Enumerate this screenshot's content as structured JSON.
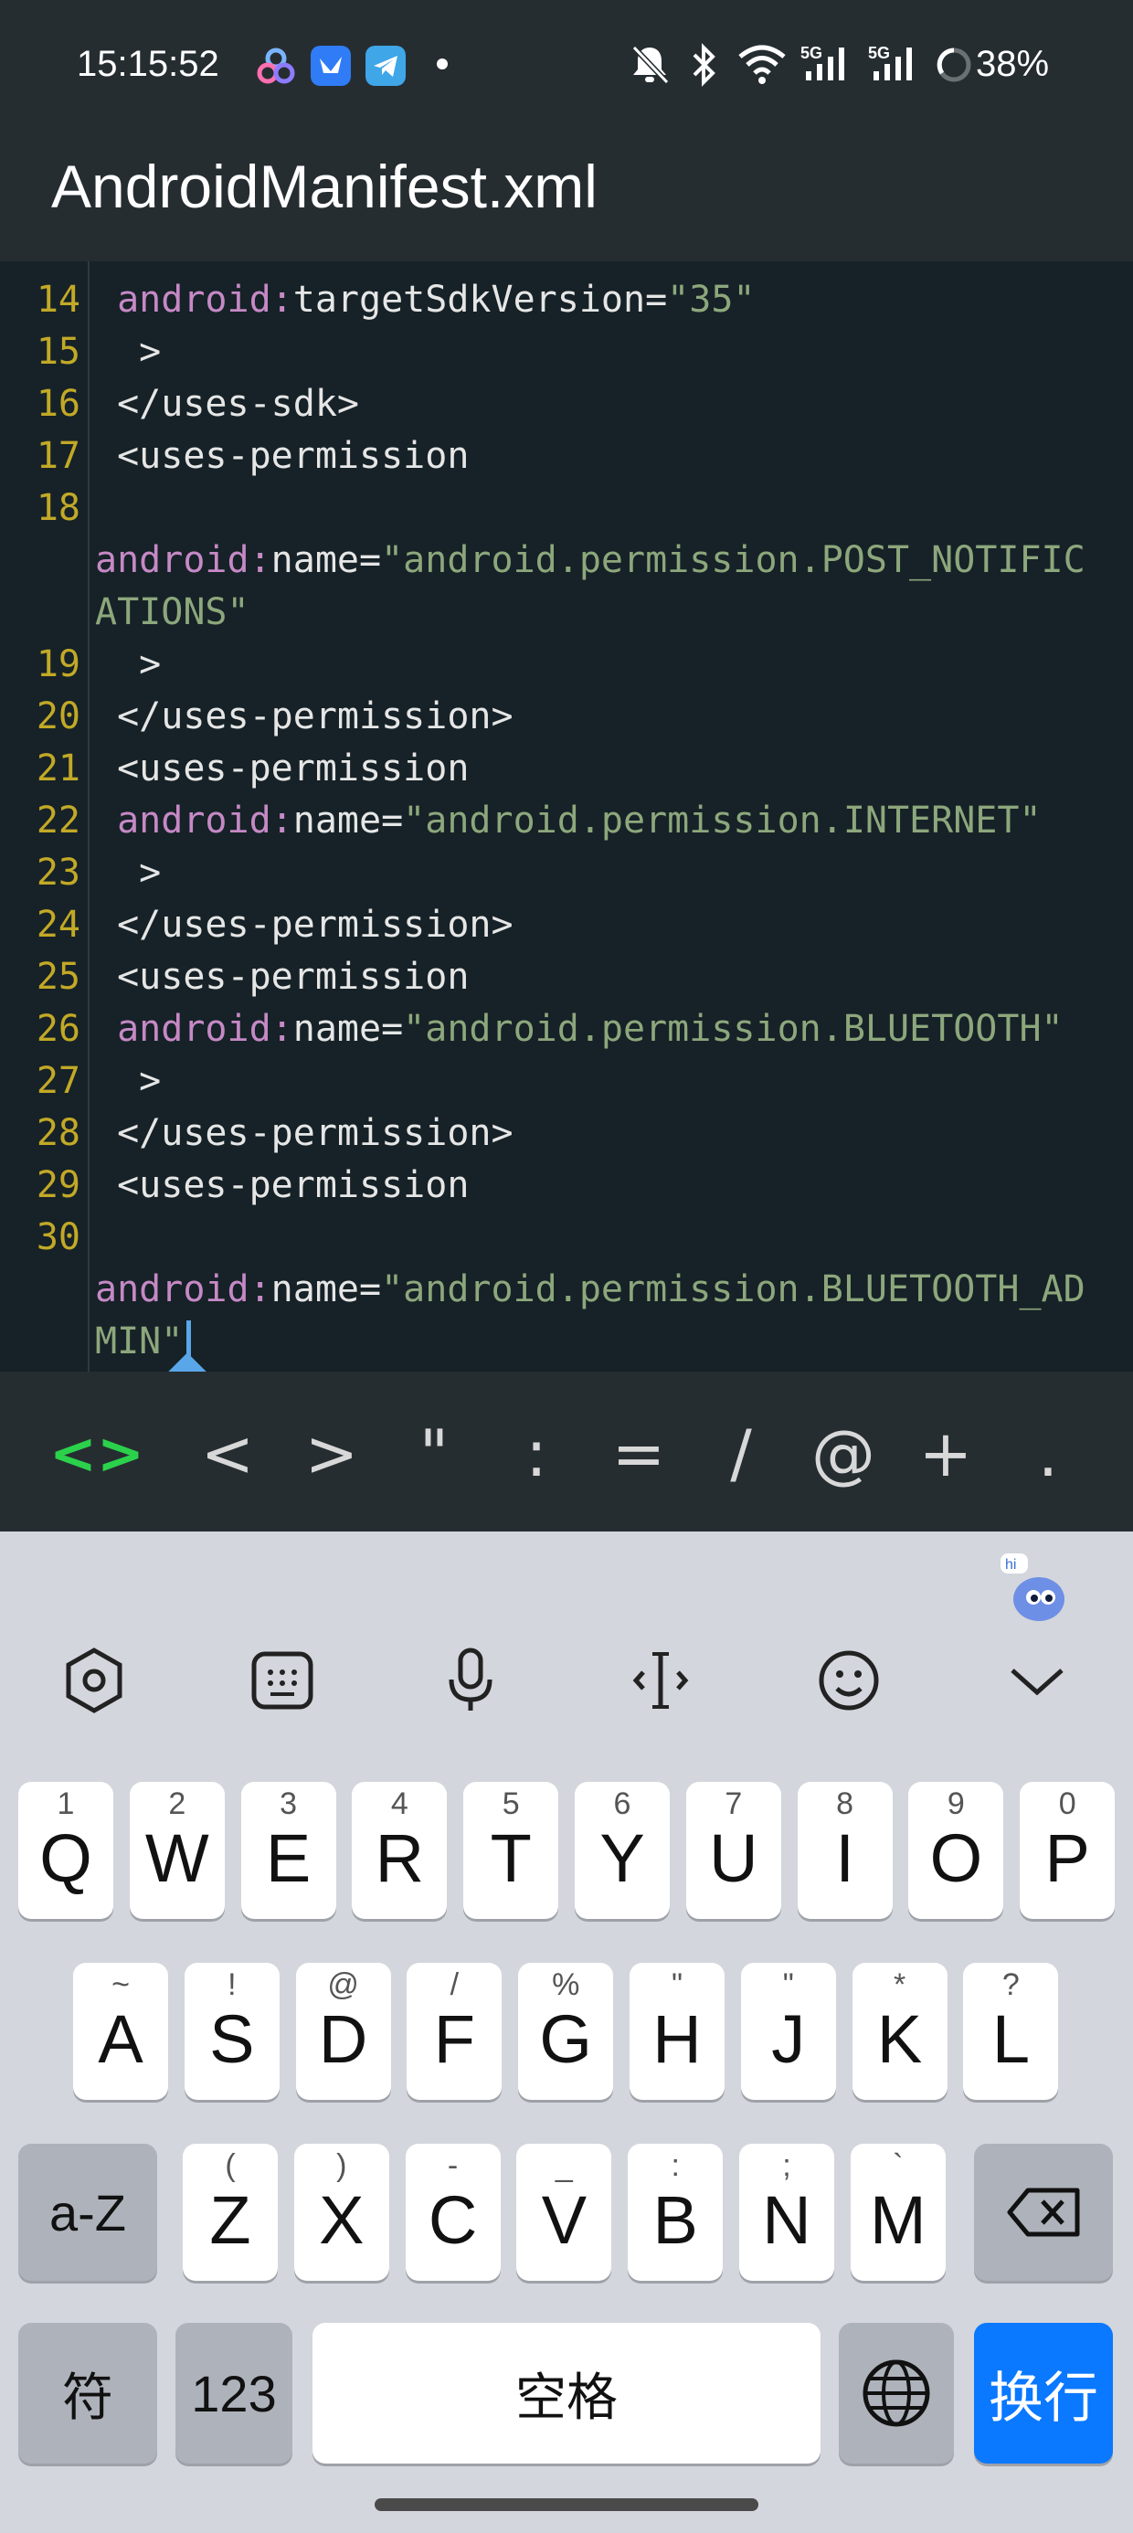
{
  "status_bar": {
    "time": "15:15:52",
    "battery_percent": "38%",
    "network_labels": [
      "5G",
      "5G"
    ],
    "icons": [
      "app-icon-1",
      "app-icon-2",
      "telegram-icon",
      "notification-dot",
      "mute-icon",
      "bluetooth-icon",
      "wifi-icon",
      "signal-icon",
      "signal-icon",
      "battery-ring-icon"
    ]
  },
  "app_bar": {
    "title": "AndroidManifest.xml"
  },
  "editor": {
    "lines": [
      {
        "n": "14",
        "indent": " ",
        "ns": "android:",
        "attr": "targetSdkVersion=",
        "str": "\"35\"",
        "plain": ""
      },
      {
        "n": "15",
        "plain": "  >"
      },
      {
        "n": "16",
        "plain": " </uses-sdk>"
      },
      {
        "n": "17",
        "plain": " <uses-permission"
      },
      {
        "n": "18",
        "plain": ""
      },
      {
        "n": "",
        "ns": "android:",
        "attr": "name=",
        "str": "\"android.permission.POST_NOTIFIC",
        "plain": ""
      },
      {
        "n": "",
        "str": "ATIONS\"",
        "plain": ""
      },
      {
        "n": "19",
        "plain": "  >"
      },
      {
        "n": "20",
        "plain": " </uses-permission>"
      },
      {
        "n": "21",
        "plain": " <uses-permission"
      },
      {
        "n": "22",
        "indent": " ",
        "ns": "android:",
        "attr": "name=",
        "str": "\"android.permission.INTERNET\"",
        "plain": ""
      },
      {
        "n": "23",
        "plain": "  >"
      },
      {
        "n": "24",
        "plain": " </uses-permission>"
      },
      {
        "n": "25",
        "plain": " <uses-permission"
      },
      {
        "n": "26",
        "indent": " ",
        "ns": "android:",
        "attr": "name=",
        "str": "\"android.permission.BLUETOOTH\"",
        "plain": ""
      },
      {
        "n": "27",
        "plain": "  >"
      },
      {
        "n": "28",
        "plain": " </uses-permission>"
      },
      {
        "n": "29",
        "plain": " <uses-permission"
      },
      {
        "n": "30",
        "plain": ""
      },
      {
        "n": "",
        "ns": "android:",
        "attr": "name=",
        "str": "\"android.permission.BLUETOOTH_AD",
        "plain": ""
      },
      {
        "n": "",
        "str": "MIN\"",
        "plain": ""
      }
    ]
  },
  "symbol_bar": {
    "tag_toggle": "<>",
    "symbols": [
      "<",
      ">",
      "\"",
      ":",
      "=",
      "/",
      "@",
      "+",
      "."
    ]
  },
  "keyboard": {
    "toolbar_icons": [
      "settings-icon",
      "keyboard-layout-icon",
      "microphone-icon",
      "cursor-move-icon",
      "emoji-icon",
      "collapse-keyboard-icon"
    ],
    "mascot_label": "hi",
    "row1": [
      {
        "main": "Q",
        "sub": "1"
      },
      {
        "main": "W",
        "sub": "2"
      },
      {
        "main": "E",
        "sub": "3"
      },
      {
        "main": "R",
        "sub": "4"
      },
      {
        "main": "T",
        "sub": "5"
      },
      {
        "main": "Y",
        "sub": "6"
      },
      {
        "main": "U",
        "sub": "7"
      },
      {
        "main": "I",
        "sub": "8"
      },
      {
        "main": "O",
        "sub": "9"
      },
      {
        "main": "P",
        "sub": "0"
      }
    ],
    "row2": [
      {
        "main": "A",
        "sub": "~"
      },
      {
        "main": "S",
        "sub": "!"
      },
      {
        "main": "D",
        "sub": "@"
      },
      {
        "main": "F",
        "sub": "/"
      },
      {
        "main": "G",
        "sub": "%"
      },
      {
        "main": "H",
        "sub": "\""
      },
      {
        "main": "J",
        "sub": "\""
      },
      {
        "main": "K",
        "sub": "*"
      },
      {
        "main": "L",
        "sub": "?"
      }
    ],
    "row3": [
      {
        "main": "Z",
        "sub": "("
      },
      {
        "main": "X",
        "sub": ")"
      },
      {
        "main": "C",
        "sub": "-"
      },
      {
        "main": "V",
        "sub": "_"
      },
      {
        "main": "B",
        "sub": ":"
      },
      {
        "main": "N",
        "sub": ";"
      },
      {
        "main": "M",
        "sub": "`"
      }
    ],
    "shift_label": "a-Z",
    "symbols_label": "符",
    "numbers_label": "123",
    "space_label": "空格",
    "enter_label": "换行",
    "accent_color": "#0a78ff"
  }
}
